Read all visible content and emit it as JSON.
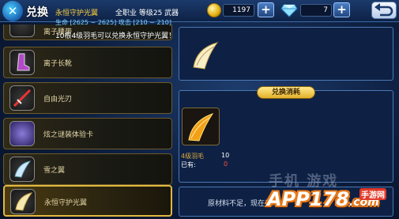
{
  "topbar": {
    "title": "兑换",
    "coins": "1197",
    "gems": "7",
    "coin_plus": "+",
    "gem_plus": "+"
  },
  "list": [
    {
      "label": "离子腰带",
      "icon": "belt-icon"
    },
    {
      "label": "离子长靴",
      "icon": "boots-icon"
    },
    {
      "label": "自由光刃",
      "icon": "blade-icon"
    },
    {
      "label": "炫之谜装体验卡",
      "icon": "card-icon"
    },
    {
      "label": "雪之翼",
      "icon": "snow-wing-icon"
    },
    {
      "label": "永恒守护光翼",
      "icon": "light-wing-icon",
      "selected": true
    }
  ],
  "detail": {
    "name": "永恒守护光翼",
    "meta": "全职业 等级25 武器",
    "stats": "生命 [2625 ~ 2625]   攻击 [210 ~ 210]",
    "desc": "10根4级羽毛可以兑换永恒守护光翼！"
  },
  "cost": {
    "tab_label": "兑换消耗",
    "material_name": "4级羽毛",
    "required": "10",
    "have_label": "已有:",
    "have": "0"
  },
  "notice": {
    "text": "原材料不足，现在无法"
  },
  "watermark": {
    "cn": "手机 游戏",
    "app": "APP178",
    "app_suffix": ".com",
    "sub": "手游网"
  },
  "colors": {
    "accent_gold": "#ffcf3a",
    "stat_blue": "#7fd4ff",
    "warn_red": "#ff4a3a"
  }
}
